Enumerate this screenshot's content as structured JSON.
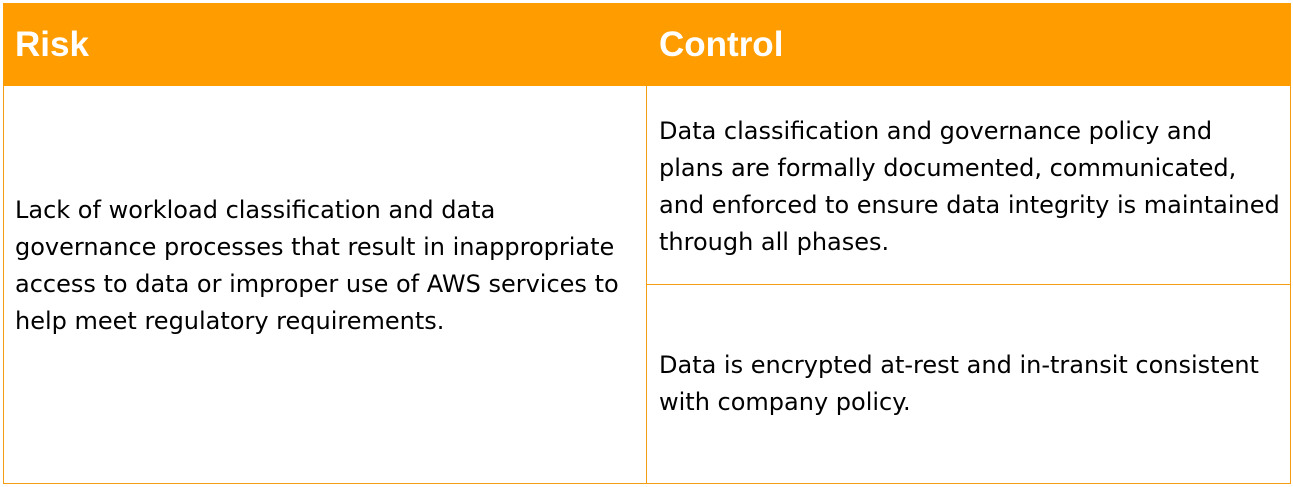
{
  "table": {
    "headers": {
      "risk": "Risk",
      "control": "Control"
    },
    "risk_text": "Lack of workload classification and data governance processes that result in inappropriate access to data or improper use of AWS services to help meet regulatory requirements.",
    "controls": [
      "Data classification and governance policy and plans are formally documented, communicated, and enforced to ensure data integrity is maintained through all phases.",
      "Data is encrypted at-rest and in-transit consistent with company policy."
    ]
  },
  "colors": {
    "header_background": "#ff9d00",
    "header_text": "#ffffff",
    "border": "#f49d12",
    "body_text": "#000000"
  }
}
